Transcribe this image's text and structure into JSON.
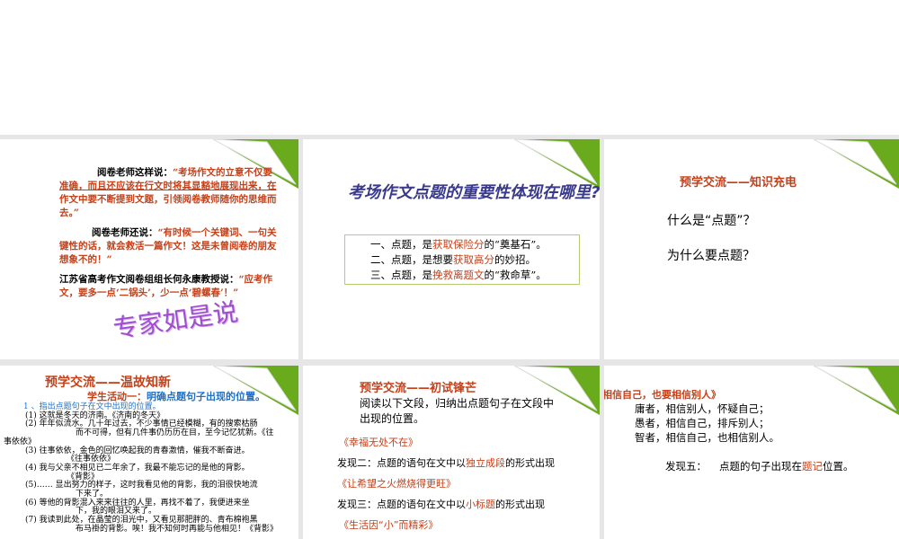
{
  "slides": [
    {
      "lines": [
        {
          "a": "阅卷老师这样说：",
          "b": "“考场作文的立意不仅要"
        },
        {
          "b": "准确，而且还应该在行文时将其显豁地展现出来，在"
        },
        {
          "b": "作文中要不断提到文题，引领阅卷教师随你的思维而"
        },
        {
          "b": "去。”"
        },
        {
          "a": "阅卷老师还说：",
          "b": "“有时候一个关键词、一句关"
        },
        {
          "b": "键性的话，就会救活一篇作文！这是未曾阅卷的朋友"
        },
        {
          "b": "想象不的！”"
        },
        {
          "a": "江苏省高考作文阅卷组组长何永康教授说：",
          "b": "“应考作"
        },
        {
          "b": "文，要多一点‘二锅头’，少一点‘碧螺春’！”"
        }
      ],
      "art_title": "专家如是说"
    },
    {
      "title": "考场作文点题的重要性体现在哪里?",
      "items": [
        {
          "a": "一、点题，是",
          "b": "获取保险分",
          "c": "的“奠基石”。"
        },
        {
          "a": "二、点题，是想要",
          "b": "获取高分",
          "c": "的妙招。"
        },
        {
          "a": "三、点题，是",
          "b": "挽救离题文",
          "c": "的“救命草”。"
        }
      ]
    },
    {
      "title": "预学交流——知识充电",
      "q1": "什么是“点题”？",
      "q2": "为什么要点题？"
    },
    {
      "title": "预学交流——温故知新",
      "subtitle_a": "学生活动一：",
      "subtitle_b": "明确点题句子出现的位置。",
      "lines": [
        "1 、指出点题句子在文中出现的位置。",
        "(1) 这就是冬天的济南。《济南的冬天》",
        "(2) 年年似流水。几十年过去，不少事情已经模糊，有的搜索枯肠",
        "而不可得，但有几件事仍历历在目，至今记忆犹新。《往",
        "事依依》",
        "(3) 往事依依，金色的回忆唤起我的青春激情，催我不断奋进。",
        "《往事依依》",
        "(4) 我与父亲不相见已二年余了，我最不能忘记的是他的背影。",
        "《背影》",
        "(5)…… 显出努力的样子，这时我看见他的背影，我的泪很快地流",
        "下来了。",
        "(6) 等他的背影混入来来往往的人里，再找不着了，我便进来坐",
        "下，我的眼泪又来了。",
        "(7) 我读到此处，在晶莹的泪光中，又看见那肥胖的、青布棉袍黑",
        "布马褂的背影。唉！我不知何时再能与他相见！《背影》"
      ]
    },
    {
      "title": "预学交流——初试锋芒",
      "intro1": "阅读以下文段，归纳出点题句子在文段中",
      "intro2": "出现的位置。",
      "work1": "《幸福无处不在》",
      "find2": {
        "a": "发现二：点题的语句在文中以",
        "b": "独立成段",
        "c": "的形式出现"
      },
      "work2": "《让希望之火燃烧得更旺》",
      "find3": {
        "a": "发现三：点题的语句在文中以",
        "b": "小标题",
        "c": "的形式出现"
      },
      "work3": "《生活因“小”而精彩》"
    },
    {
      "work": "相信自己，也要相信别人》",
      "lines": [
        "庸者，相信别人，怀疑自己；",
        "愚者，相信自己，排斥别人；",
        "智者，相信自己，也相信别人。"
      ],
      "find5": {
        "label": "发现五：",
        "a": "点题的句子出现在",
        "b": "题记",
        "c": "位置。"
      }
    }
  ]
}
